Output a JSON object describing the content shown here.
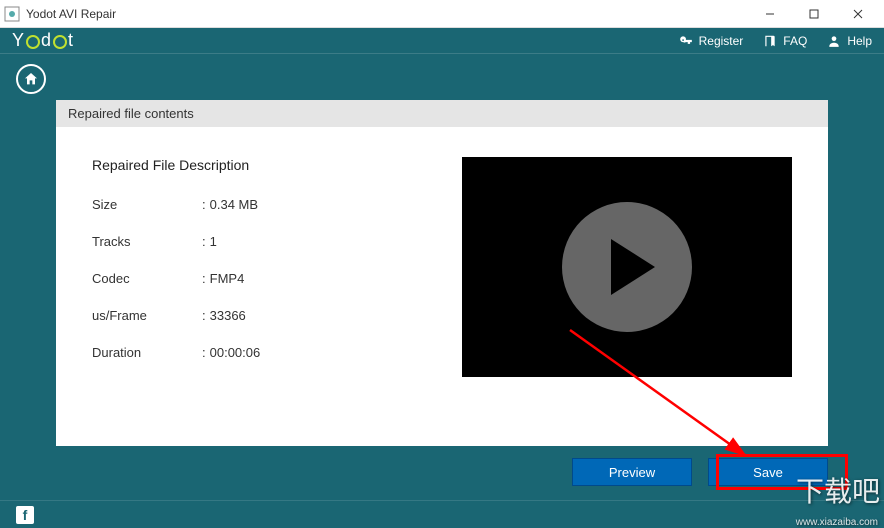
{
  "window": {
    "title": "Yodot AVI Repair"
  },
  "logo": {
    "text1": "Y",
    "text2": "d",
    "text3": "t"
  },
  "topmenu": {
    "register": "Register",
    "faq": "FAQ",
    "help": "Help"
  },
  "section": {
    "header": "Repaired file contents",
    "desc_title": "Repaired File Description",
    "rows": {
      "size": {
        "label": "Size",
        "value": "0.34 MB"
      },
      "tracks": {
        "label": "Tracks",
        "value": "1"
      },
      "codec": {
        "label": "Codec",
        "value": "FMP4"
      },
      "usframe": {
        "label": "us/Frame",
        "value": "33366"
      },
      "duration": {
        "label": "Duration",
        "value": "00:00:06"
      }
    }
  },
  "buttons": {
    "preview": "Preview",
    "save": "Save"
  },
  "watermark": {
    "main": "下载吧",
    "sub": "www.xiazaiba.com"
  }
}
